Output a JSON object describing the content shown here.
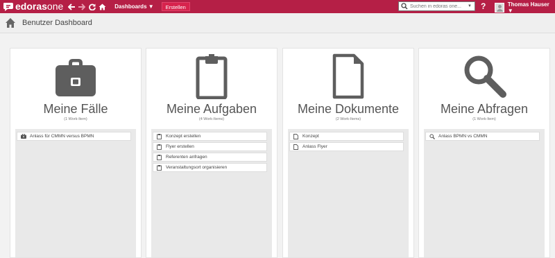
{
  "topbar": {
    "brand_bold": "edoras",
    "brand_light": "one",
    "dashboards_label": "Dashboards ▼",
    "create_label": "Erstellen",
    "search_placeholder": "Suchen in edoras one...",
    "help_label": "?",
    "user_name": "Thomas Hauser ▼",
    "accent": "#b51f46"
  },
  "subheader": {
    "title": "Benutzer Dashboard"
  },
  "cards": [
    {
      "title": "Meine Fälle",
      "count": "(1 Work-Item)",
      "icon": "briefcase-icon",
      "items": [
        {
          "label": "Anlass für CMMN versus BPMN",
          "icon": "case-icon"
        }
      ]
    },
    {
      "title": "Meine Aufgaben",
      "count": "(4 Work-Items)",
      "icon": "clipboard-icon",
      "items": [
        {
          "label": "Konzept erstellen",
          "icon": "task-icon"
        },
        {
          "label": "Flyer erstellen",
          "icon": "task-icon"
        },
        {
          "label": "Referenten anfragen",
          "icon": "task-icon"
        },
        {
          "label": "Veranstaltungsort organisieren",
          "icon": "task-icon"
        }
      ]
    },
    {
      "title": "Meine Dokumente",
      "count": "(2 Work-Items)",
      "icon": "document-icon",
      "items": [
        {
          "label": "Konzept",
          "icon": "document-icon"
        },
        {
          "label": "Anlass Flyer",
          "icon": "document-icon"
        }
      ]
    },
    {
      "title": "Meine Abfragen",
      "count": "(1 Work-Item)",
      "icon": "magnifier-icon",
      "items": [
        {
          "label": "Anlass BPMN vs CMMN",
          "icon": "search-icon"
        }
      ]
    }
  ]
}
